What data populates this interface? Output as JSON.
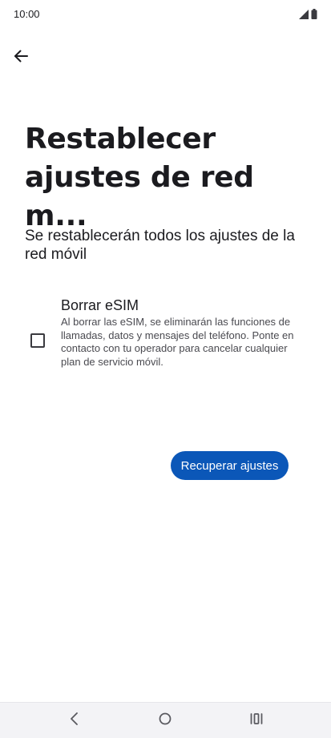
{
  "status_bar": {
    "time": "10:00",
    "icons": [
      "signal-icon",
      "battery-icon"
    ]
  },
  "header": {
    "back_icon": "arrow-left-icon"
  },
  "page": {
    "title": "Restablecer ajustes de red m...",
    "description": "Se restablecerán todos los ajustes de la red móvil"
  },
  "option": {
    "label": "Borrar eSIM",
    "description": "Al borrar las eSIM, se eliminarán las funciones de llamadas, datos y mensajes del teléfono. Ponte en contacto con tu operador para cancelar cualquier plan de servicio móvil.",
    "checked": false
  },
  "actions": {
    "primary_label": "Recuperar ajustes"
  },
  "nav": {
    "icons": [
      "back-icon",
      "home-icon",
      "recents-icon"
    ]
  },
  "colors": {
    "accent": "#0b57b8",
    "background": "#ffffff",
    "nav_background": "#f3f3f6"
  }
}
